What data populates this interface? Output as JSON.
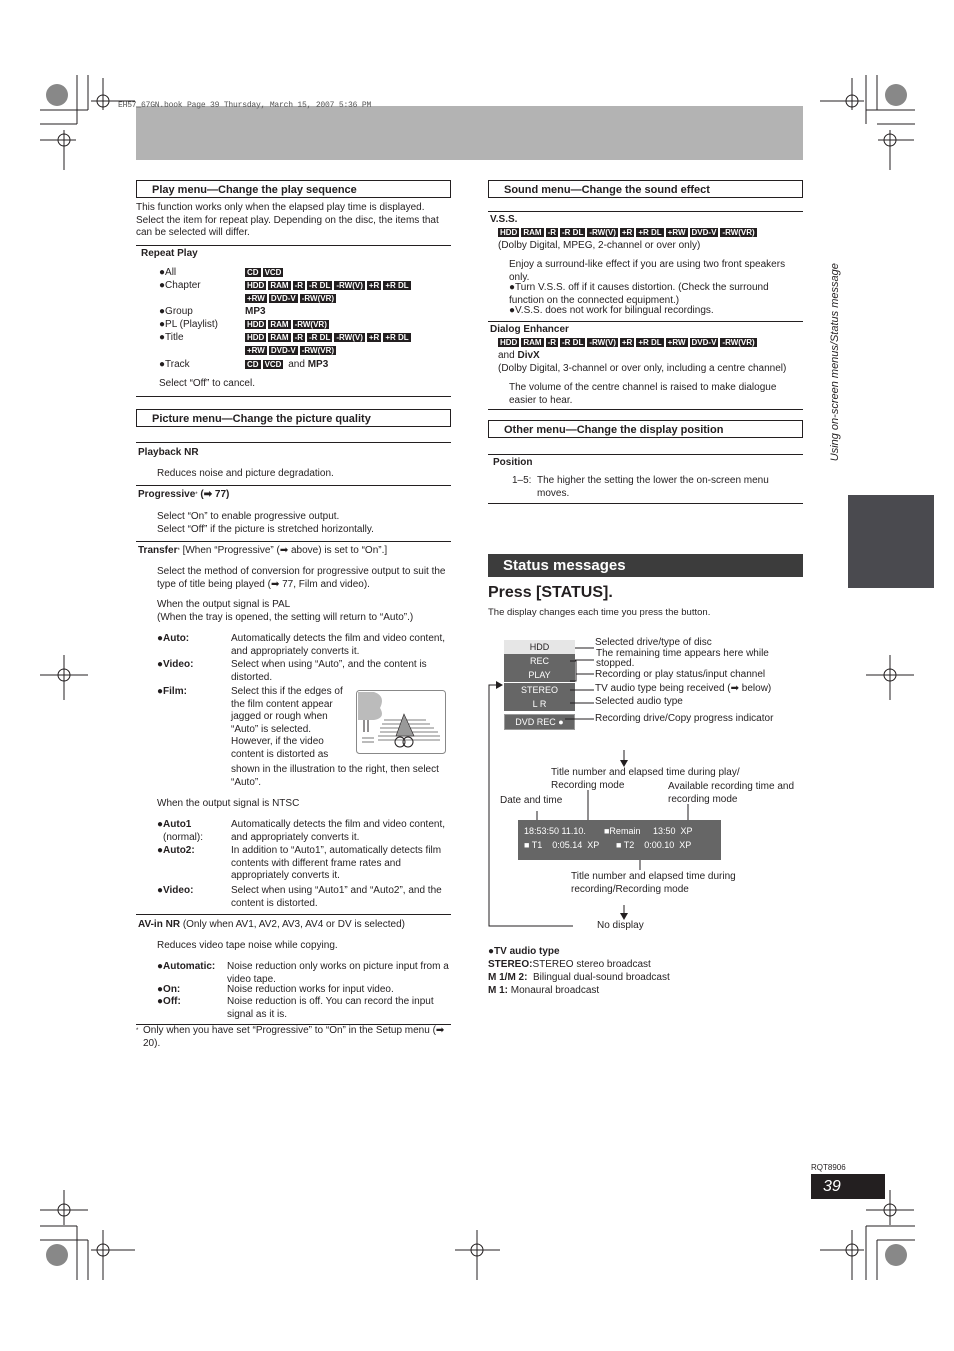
{
  "header": {
    "book_line": "EH57_67GN.book  Page 39  Thursday, March 15, 2007  5:36 PM"
  },
  "side_tab": {
    "label": "Using on-screen menus/Status message"
  },
  "play_menu": {
    "title": "Play menu—Change the play sequence",
    "intro": "This function works only when the elapsed play time is displayed. Select the item for repeat play. Depending on the disc, the items that can be selected will differ.",
    "repeat_play_label": "Repeat Play",
    "items": [
      {
        "label": "●All",
        "badges": [
          "CD",
          "VCD"
        ],
        "suffix": ""
      },
      {
        "label": "●Chapter",
        "badges": [
          "HDD",
          "RAM",
          "-R",
          "-R DL",
          "-RW(V)",
          "+R",
          "+R DL"
        ],
        "badges2": [
          "+RW",
          "DVD-V",
          "-RW(VR)"
        ]
      },
      {
        "label": "●Group",
        "text": "MP3"
      },
      {
        "label": "●PL (Playlist)",
        "badges": [
          "HDD",
          "RAM",
          "-RW(VR)"
        ]
      },
      {
        "label": "●Title",
        "badges": [
          "HDD",
          "RAM",
          "-R",
          "-R DL",
          "-RW(V)",
          "+R",
          "+R DL"
        ],
        "badges2": [
          "+RW",
          "DVD-V",
          "-RW(VR)"
        ]
      },
      {
        "label": "●Track",
        "badges": [
          "CD",
          "VCD"
        ],
        "and": "and",
        "text": "MP3"
      }
    ],
    "cancel_note": "Select “Off” to cancel."
  },
  "picture_menu": {
    "title": "Picture menu—Change the picture quality",
    "playback_nr_label": "Playback NR",
    "playback_nr_desc": "Reduces noise and picture degradation.",
    "progressive_label": "Progressive",
    "progressive_ref": "(➡ 77)",
    "progressive_desc1": "Select “On” to enable progressive output.",
    "progressive_desc2": "Select “Off” if the picture is stretched horizontally.",
    "transfer_label": "Transfer",
    "transfer_cond": "[When “Progressive” (➡ above) is set to “On”.]",
    "transfer_desc": "Select the method of conversion for progressive output to suit the type of title being played (➡ 77, Film and video).",
    "pal_heading": "When the output signal is PAL",
    "pal_note": "(When the tray is opened, the setting will return to “Auto”.)",
    "pal_options": [
      {
        "key": "●Auto:",
        "desc": "Automatically detects the film and video content, and appropriately converts it."
      },
      {
        "key": "●Video:",
        "desc": "Select when using “Auto”, and the content is distorted."
      },
      {
        "key": "●Film:",
        "desc": "Select this if the edges of the film content appear jagged or rough when “Auto” is selected. However, if the video content is distorted as",
        "desc_cont": "shown in the illustration to the right, then select “Auto”."
      }
    ],
    "ntsc_heading": "When the output signal is NTSC",
    "ntsc_options": [
      {
        "key": "●Auto1",
        "key2": "(normal):",
        "desc": "Automatically detects the film and video content, and appropriately converts it."
      },
      {
        "key": "●Auto2:",
        "desc": "In addition to “Auto1”, automatically detects film contents with different frame rates and appropriately converts it."
      },
      {
        "key": "●Video:",
        "desc": "Select when using “Auto1” and “Auto2”, and the content is distorted."
      }
    ],
    "avin_label": "AV-in NR",
    "avin_cond": "(Only when AV1, AV2, AV3, AV4 or DV is selected)",
    "avin_desc": "Reduces video tape noise while copying.",
    "avin_options": [
      {
        "key": "●Automatic:",
        "desc": "Noise reduction only works on picture input from a video tape."
      },
      {
        "key": "●On:",
        "desc": "Noise reduction works for input video."
      },
      {
        "key": "●Off:",
        "desc": "Noise reduction is off. You can record the input signal as it is."
      }
    ],
    "footnote": "Only when you have set “Progressive” to “On” in the Setup menu (➡ 20)."
  },
  "sound_menu": {
    "title": "Sound menu—Change the sound effect",
    "vss_label": "V.S.S.",
    "badges": [
      "HDD",
      "RAM",
      "-R",
      "-R DL",
      "-RW(V)",
      "+R",
      "+R DL",
      "+RW",
      "DVD-V",
      "-RW(VR)"
    ],
    "vss_note": "(Dolby Digital, MPEG, 2-channel or over only)",
    "vss_desc": "Enjoy a surround-like effect if you are using two front speakers only.",
    "vss_bullets": [
      "●Turn V.S.S. off if it causes distortion. (Check the surround function on the connected equipment.)",
      "●V.S.S. does not work for bilingual recordings."
    ],
    "dialog_label": "Dialog Enhancer",
    "dialog_and": "and",
    "dialog_divx": "DivX",
    "dialog_note": "(Dolby Digital, 3-channel or over only, including a centre channel)",
    "dialog_desc": "The volume of the centre channel is raised to make dialogue easier to hear."
  },
  "other_menu": {
    "title": "Other menu—Change the display position",
    "position_label": "Position",
    "position_range": "1–5:",
    "position_desc": "The higher the setting the lower the on-screen menu moves."
  },
  "status": {
    "title": "Status messages",
    "press": "Press [STATUS].",
    "subtitle": "The display changes each time you press the button.",
    "osd_rows": [
      "HDD",
      "REC",
      "PLAY",
      "STEREO",
      "L R",
      "DVD REC ●"
    ],
    "callouts": [
      "Selected drive/type of disc",
      "The remaining time appears here while stopped.",
      "Recording or play status/input channel",
      "TV audio type being received (➡ below)",
      "Selected audio type",
      "Recording drive/Copy progress indicator"
    ],
    "osd2": {
      "datetime": "18:53:50 11.10.",
      "play_title": "■ T1    0:05.14  XP",
      "remain": "■Remain     13:50  XP",
      "rec_title": "■ T2    0:00.10  XP"
    },
    "labels": {
      "title_play": "Title number and elapsed time during play/ Recording mode",
      "available": "Available recording time and recording mode",
      "date_time": "Date and time",
      "title_rec": "Title number and elapsed time during recording/Recording mode",
      "no_display": "No display"
    },
    "tv_audio": {
      "heading": "●TV audio type",
      "rows": [
        {
          "key": "STEREO:",
          "desc": "STEREO stereo broadcast"
        },
        {
          "key": "M 1/M 2:",
          "desc": "Bilingual dual-sound broadcast"
        },
        {
          "key": "M 1:",
          "desc": "Monaural broadcast"
        }
      ]
    }
  },
  "footer": {
    "doc_code": "RQT8906",
    "page_number": "39"
  }
}
